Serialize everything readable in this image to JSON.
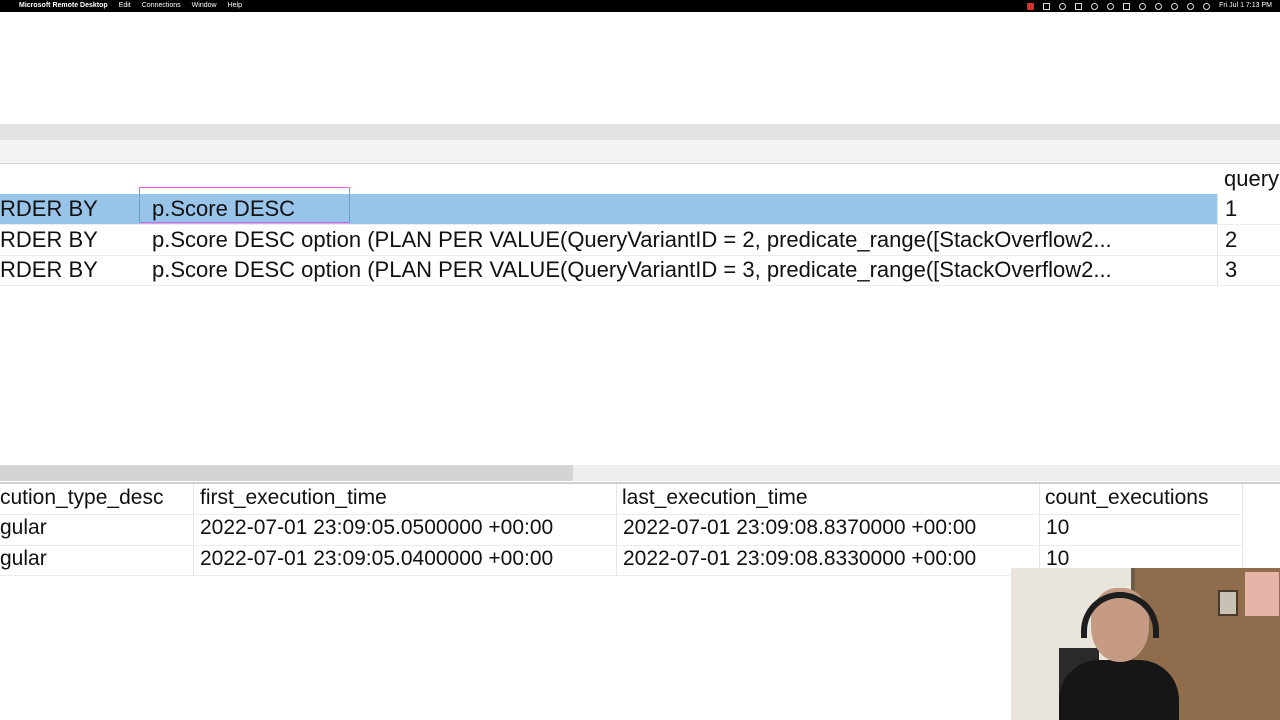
{
  "menubar": {
    "app_name": "Microsoft Remote Desktop",
    "menus": [
      "Edit",
      "Connections",
      "Window",
      "Help"
    ],
    "clock": "Fri Jul 1  7:13 PM"
  },
  "top_grid": {
    "header_query": "query",
    "rows": [
      {
        "c1": "RDER BY",
        "c2": "p.Score DESC",
        "c3": "1"
      },
      {
        "c1": "RDER BY",
        "c2": "p.Score DESC option (PLAN PER VALUE(QueryVariantID = 2, predicate_range([StackOverflow2...",
        "c3": "2"
      },
      {
        "c1": "RDER BY",
        "c2": "p.Score DESC option (PLAN PER VALUE(QueryVariantID = 3, predicate_range([StackOverflow2...",
        "c3": "3"
      }
    ]
  },
  "bottom_grid": {
    "headers": [
      "cution_type_desc",
      "first_execution_time",
      "last_execution_time",
      "count_executions"
    ],
    "rows": [
      [
        "gular",
        "2022-07-01 23:09:05.0500000 +00:00",
        "2022-07-01 23:09:08.8370000 +00:00",
        "10"
      ],
      [
        "gular",
        "2022-07-01 23:09:05.0400000 +00:00",
        "2022-07-01 23:09:08.8330000 +00:00",
        "10"
      ]
    ]
  },
  "colors": {
    "selection": "#99c4ea",
    "focus_border": "#e060e0"
  }
}
